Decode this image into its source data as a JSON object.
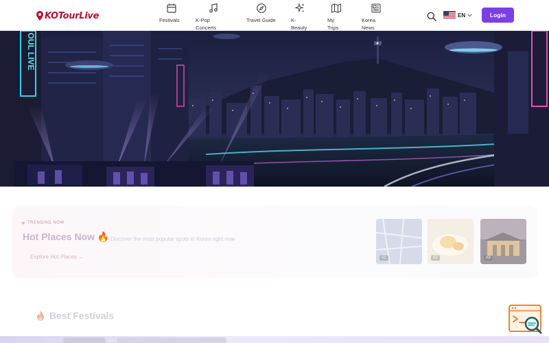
{
  "brand": {
    "name": "KOTourLive",
    "color": "#b3123a"
  },
  "nav": {
    "items": [
      {
        "label": "Festivals",
        "icon": "calendar-icon"
      },
      {
        "label": "K-Pop Concerts",
        "icon": "music-note-icon"
      },
      {
        "label": "Travel Guide",
        "icon": "compass-icon"
      },
      {
        "label": "K-Beauty",
        "icon": "sparkles-icon"
      },
      {
        "label": "My Trips",
        "icon": "map-icon"
      },
      {
        "label": "Korea News",
        "icon": "newspaper-icon"
      }
    ],
    "language": "EN",
    "login_label": "Login",
    "accent": "#7b3fe4"
  },
  "hot_places": {
    "tag": "TRENDING NOW",
    "title": "Hot Places Now 🔥",
    "description": "Discover the most popular spots in Korea right now",
    "cta": "Explore Hot Places →",
    "thumbs": [
      {
        "num": "#1"
      },
      {
        "num": "#2"
      },
      {
        "num": "#3"
      }
    ]
  },
  "best_festivals": {
    "title": "Best Festivals"
  }
}
